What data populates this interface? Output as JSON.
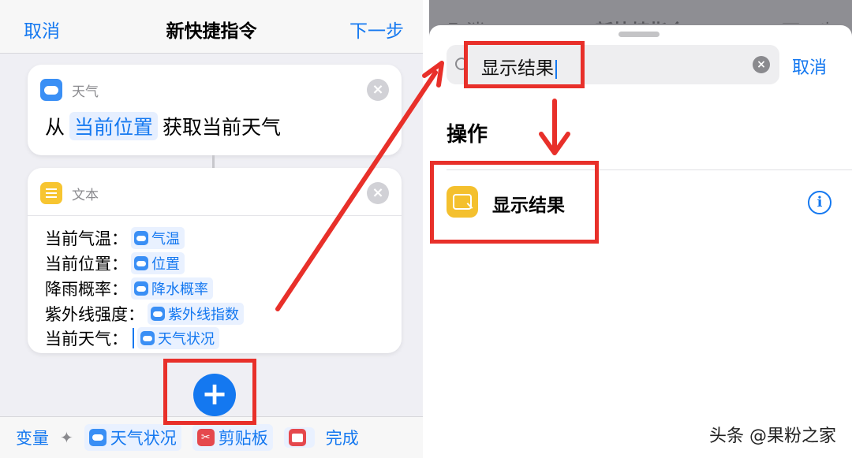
{
  "left": {
    "nav": {
      "cancel": "取消",
      "title": "新快捷指令",
      "next": "下一步"
    },
    "weather_card": {
      "label": "天气",
      "prefix": "从",
      "token": "当前位置",
      "suffix": "获取当前天气"
    },
    "text_card": {
      "label": "文本",
      "lines": [
        {
          "label": "当前气温：",
          "var": "气温"
        },
        {
          "label": "当前位置：",
          "var": "位置"
        },
        {
          "label": "降雨概率：",
          "var": "降水概率"
        },
        {
          "label": "紫外线强度：",
          "var": "紫外线指数"
        },
        {
          "label": "当前天气：",
          "var": "天气状况"
        }
      ]
    },
    "add_button": "+",
    "bottom_bar": {
      "variables": "变量",
      "weather_chip": "天气状况",
      "clipboard_chip": "剪贴板",
      "done": "完成"
    }
  },
  "right": {
    "dim_nav": {
      "cancel": "取消",
      "title": "新快捷指令",
      "next": "下一步"
    },
    "search": {
      "value": "显示结果",
      "cancel": "取消"
    },
    "section_title": "操作",
    "result": {
      "label": "显示结果"
    },
    "watermark": "头条 @果粉之家"
  },
  "colors": {
    "accent": "#1478f0",
    "highlight": "#e8302a",
    "weather_icon": "#3a8ff5",
    "text_icon": "#f7c531",
    "result_icon": "#f4c02e"
  }
}
